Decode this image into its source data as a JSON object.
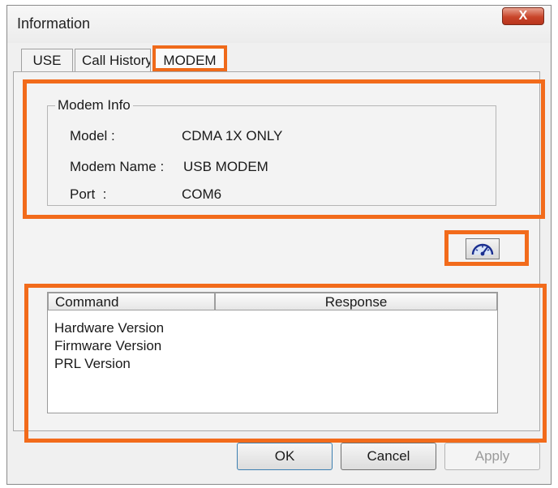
{
  "window": {
    "title": "Information",
    "close_glyph": "X"
  },
  "tabs": [
    {
      "label": "USE"
    },
    {
      "label": "Call History"
    },
    {
      "label": "MODEM",
      "selected": true
    }
  ],
  "modem_info": {
    "legend": "Modem Info",
    "rows": [
      {
        "label": "Model :",
        "value": "CDMA 1X ONLY"
      },
      {
        "label": "Modem Name :",
        "value": "USB MODEM"
      },
      {
        "label": "Port  :",
        "value": "COM6"
      }
    ]
  },
  "diagnostic_button": {
    "icon": "speedometer-icon"
  },
  "command_table": {
    "columns": [
      "Command",
      "Response"
    ],
    "rows": [
      {
        "command": "Hardware Version",
        "response": ""
      },
      {
        "command": "Firmware Version",
        "response": ""
      },
      {
        "command": "PRL Version",
        "response": ""
      }
    ]
  },
  "buttons": {
    "ok": "OK",
    "cancel": "Cancel",
    "apply": "Apply"
  },
  "highlight_color": "#f26b1b"
}
